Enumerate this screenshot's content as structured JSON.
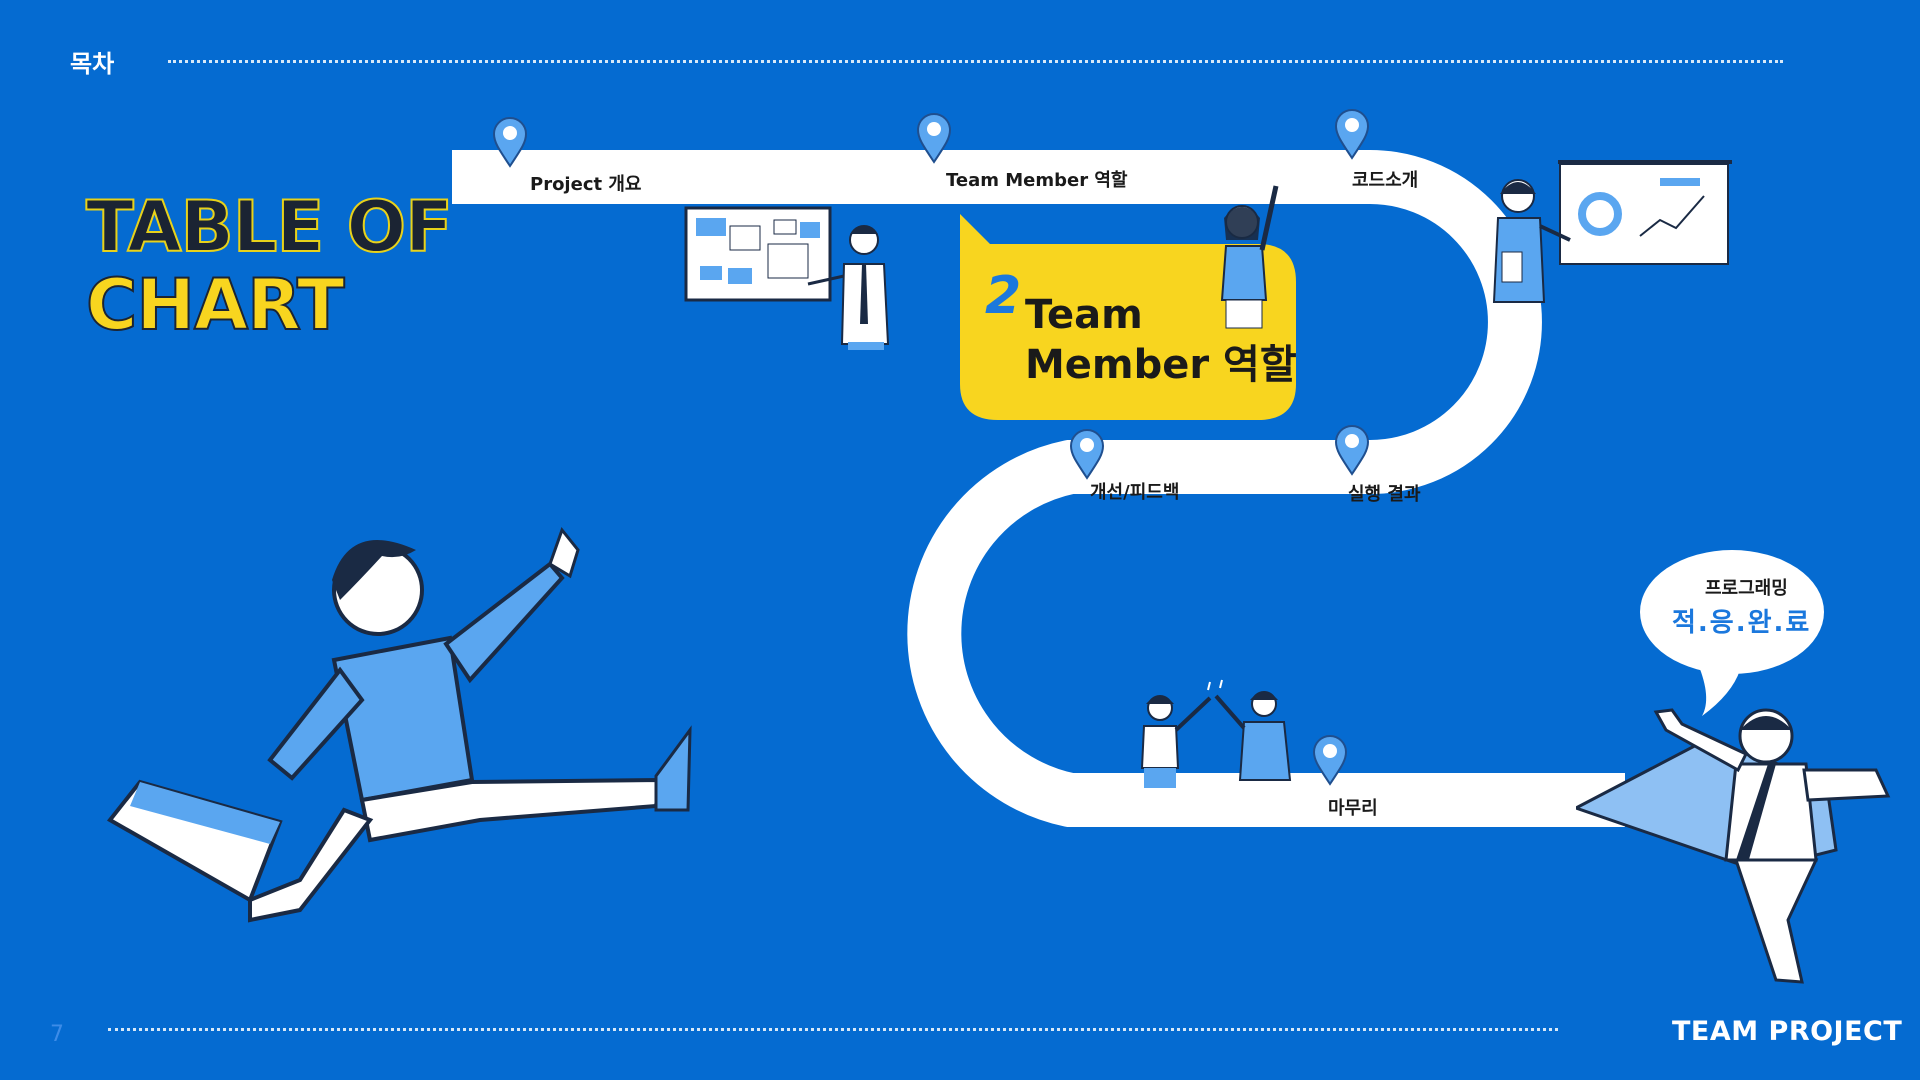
{
  "header": {
    "title": "목차"
  },
  "toc": {
    "line1": "TABLE OF",
    "line2": "CHART"
  },
  "stops": [
    {
      "label": "Project 개요"
    },
    {
      "label": "Team Member 역할"
    },
    {
      "label": "코드소개"
    },
    {
      "label": "개선/피드백"
    },
    {
      "label": "실행 결과"
    },
    {
      "label": "마무리"
    }
  ],
  "highlight": {
    "number": "2",
    "line1": "Team",
    "line2": "Member 역할"
  },
  "speech": {
    "line1": "프로그래밍",
    "line2": "적.응.완.료"
  },
  "footer": {
    "page": "7",
    "title": "TEAM PROJECT"
  },
  "colors": {
    "background": "#056bd1",
    "accent_yellow": "#f8d51f",
    "pin": "#5aa6f0",
    "road": "#ffffff"
  }
}
